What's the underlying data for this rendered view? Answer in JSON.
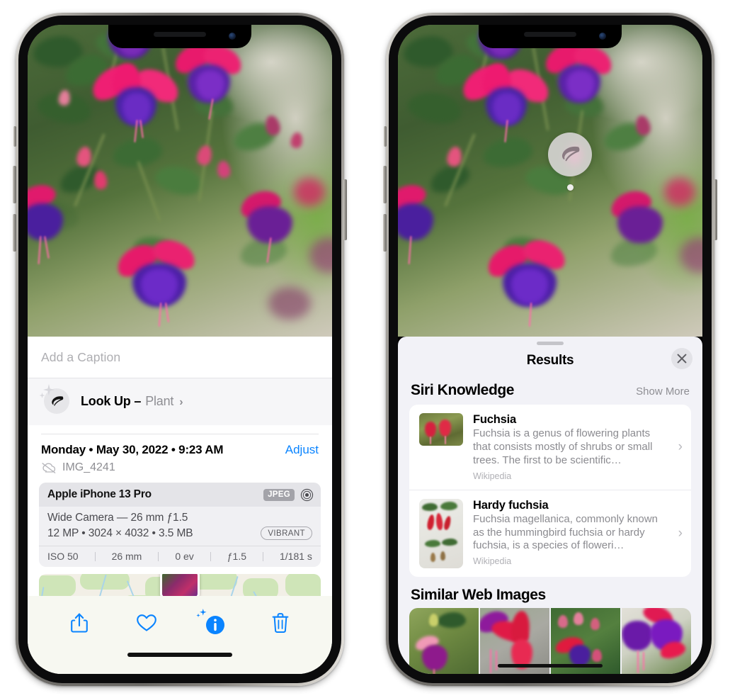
{
  "left_phone": {
    "caption": {
      "placeholder": "Add a Caption",
      "value": ""
    },
    "lookup": {
      "label": "Look Up –",
      "subject": "Plant",
      "chevron": "›",
      "icon": "leaf-icon"
    },
    "meta": {
      "datetime": "Monday • May 30, 2022 • 9:23 AM",
      "adjust_label": "Adjust",
      "filename": "IMG_4241",
      "cloud_icon": "cloud-slash-icon"
    },
    "camera_card": {
      "model": "Apple iPhone 13 Pro",
      "format_badge": "JPEG",
      "lens_icon": "aperture-icon",
      "lens_line": "Wide Camera — 26 mm ƒ1.5",
      "spec_line": "12 MP • 3024 × 4032 • 3.5 MB",
      "style_pill": "VIBRANT",
      "exif": [
        "ISO 50",
        "26 mm",
        "0 ev",
        "ƒ1.5",
        "1/181 s"
      ]
    },
    "toolbar": [
      {
        "name": "share-button",
        "icon": "share-icon"
      },
      {
        "name": "favorite-button",
        "icon": "heart-icon"
      },
      {
        "name": "info-button",
        "icon": "info-sparkle-icon"
      },
      {
        "name": "delete-button",
        "icon": "trash-icon"
      }
    ],
    "accent_color": "#0a84ff"
  },
  "right_phone": {
    "pin": {
      "icon": "leaf-icon"
    },
    "sheet": {
      "title": "Results",
      "close_icon": "close-icon",
      "sections": [
        {
          "title": "Siri Knowledge",
          "action": "Show More",
          "items": [
            {
              "title": "Fuchsia",
              "description": "Fuchsia is a genus of flowering plants that consists mostly of shrubs or small trees. The first to be scientific…",
              "source": "Wikipedia",
              "chevron": "›"
            },
            {
              "title": "Hardy fuchsia",
              "description": "Fuchsia magellanica, commonly known as the hummingbird fuchsia or hardy fuchsia, is a species of floweri…",
              "source": "Wikipedia",
              "chevron": "›"
            }
          ]
        },
        {
          "title": "Similar Web Images",
          "action": "",
          "thumbnails": [
            "fuchsia-web-1",
            "fuchsia-web-2",
            "fuchsia-web-3",
            "fuchsia-web-4"
          ]
        }
      ]
    }
  }
}
